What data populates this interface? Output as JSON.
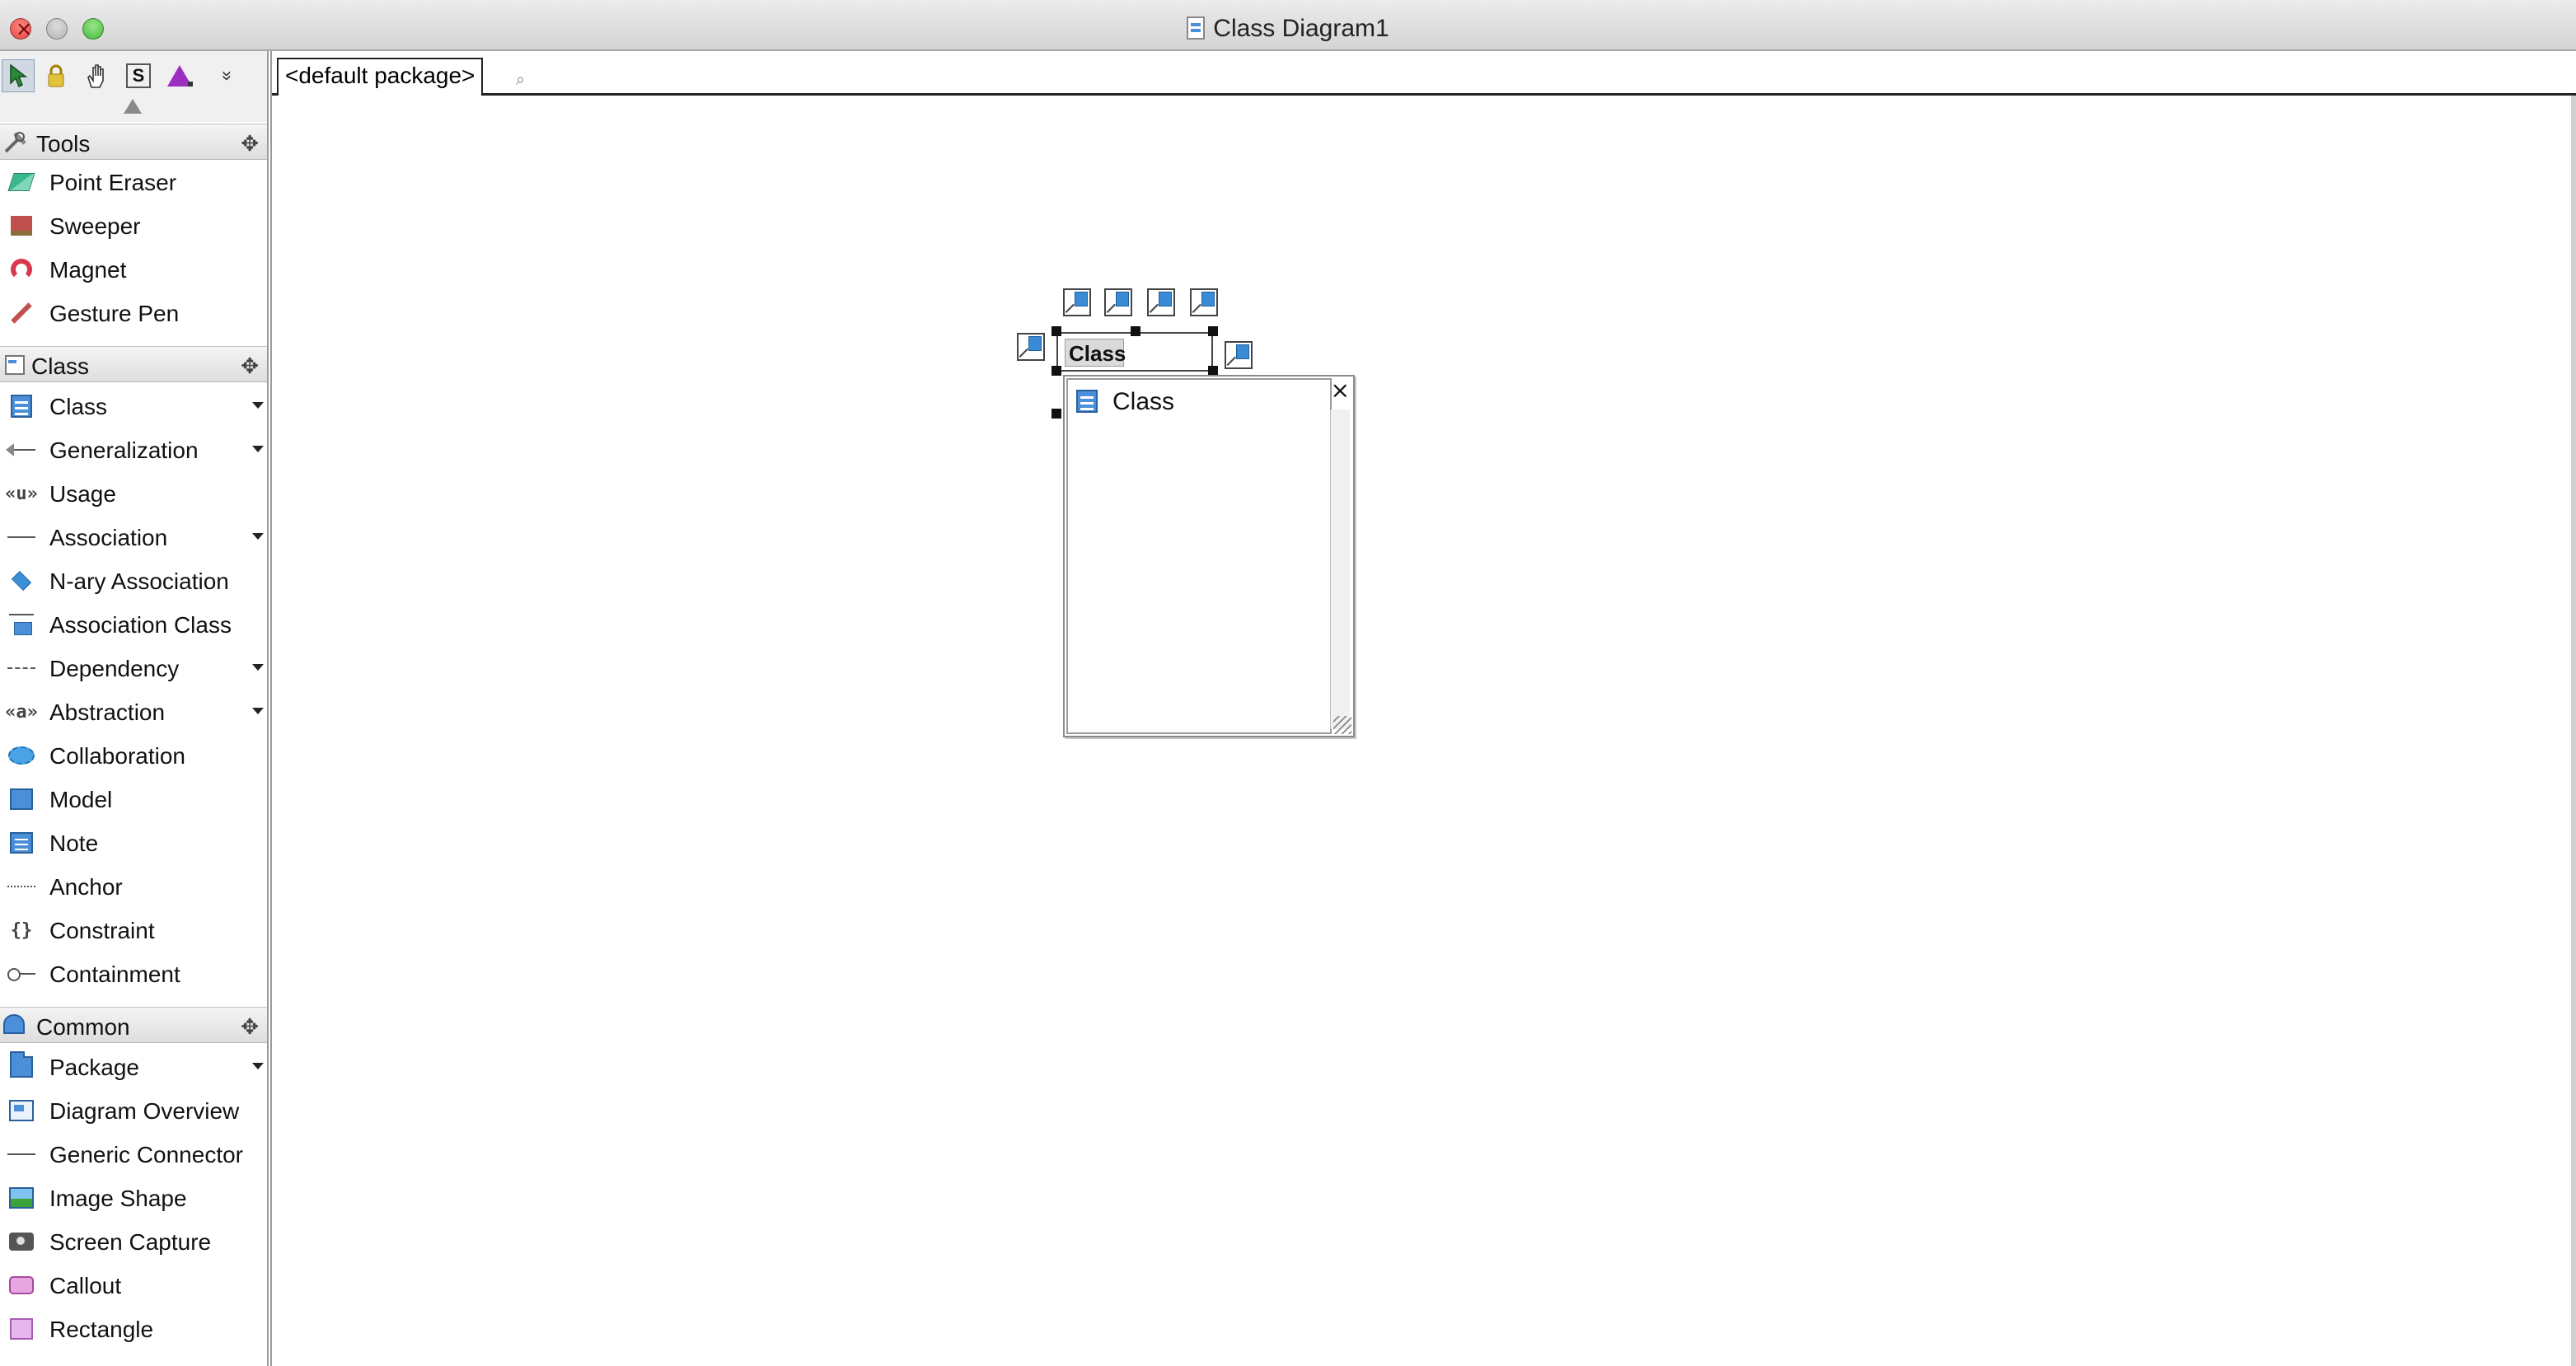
{
  "window": {
    "title": "Class Diagram1"
  },
  "toolbar": {
    "buttons": [
      "pointer-icon",
      "lock-icon",
      "hand-icon",
      "sweeper-s-icon",
      "shape-icon",
      "more-icon"
    ],
    "sweeper_letter": "S",
    "more_glyph": "»"
  },
  "palette": {
    "groups": [
      {
        "label": "Tools",
        "items": [
          {
            "label": "Point Eraser",
            "icon": "eraser-icon"
          },
          {
            "label": "Sweeper",
            "icon": "sweeper-icon"
          },
          {
            "label": "Magnet",
            "icon": "magnet-icon"
          },
          {
            "label": "Gesture Pen",
            "icon": "pen-icon"
          }
        ]
      },
      {
        "label": "Class",
        "items": [
          {
            "label": "Class",
            "icon": "class-icon",
            "dropdown": true
          },
          {
            "label": "Generalization",
            "icon": "generalization-icon",
            "dropdown": true
          },
          {
            "label": "Usage",
            "icon": "usage-icon",
            "icon_text": "«u»"
          },
          {
            "label": "Association",
            "icon": "association-icon",
            "dropdown": true
          },
          {
            "label": "N-ary Association",
            "icon": "nary-association-icon"
          },
          {
            "label": "Association Class",
            "icon": "association-class-icon"
          },
          {
            "label": "Dependency",
            "icon": "dependency-icon",
            "dropdown": true
          },
          {
            "label": "Abstraction",
            "icon": "abstraction-icon",
            "icon_text": "«a»",
            "dropdown": true
          },
          {
            "label": "Collaboration",
            "icon": "collaboration-icon"
          },
          {
            "label": "Model",
            "icon": "model-icon"
          },
          {
            "label": "Note",
            "icon": "note-icon"
          },
          {
            "label": "Anchor",
            "icon": "anchor-icon"
          },
          {
            "label": "Constraint",
            "icon": "constraint-icon",
            "icon_text": "{}"
          },
          {
            "label": "Containment",
            "icon": "containment-icon"
          }
        ]
      },
      {
        "label": "Common",
        "items": [
          {
            "label": "Package",
            "icon": "package-icon",
            "dropdown": true
          },
          {
            "label": "Diagram Overview",
            "icon": "diagram-overview-icon"
          },
          {
            "label": "Generic Connector",
            "icon": "generic-connector-icon"
          },
          {
            "label": "Image Shape",
            "icon": "image-shape-icon"
          },
          {
            "label": "Screen Capture",
            "icon": "camera-icon"
          },
          {
            "label": "Callout",
            "icon": "callout-icon"
          },
          {
            "label": "Rectangle",
            "icon": "rectangle-icon"
          }
        ]
      }
    ]
  },
  "diagram": {
    "package_tab": "<default package>",
    "class_shape": {
      "name_value": "Class"
    },
    "popup": {
      "close_glyph": "×",
      "items": [
        {
          "label": "Class",
          "icon": "class-icon"
        }
      ]
    }
  }
}
